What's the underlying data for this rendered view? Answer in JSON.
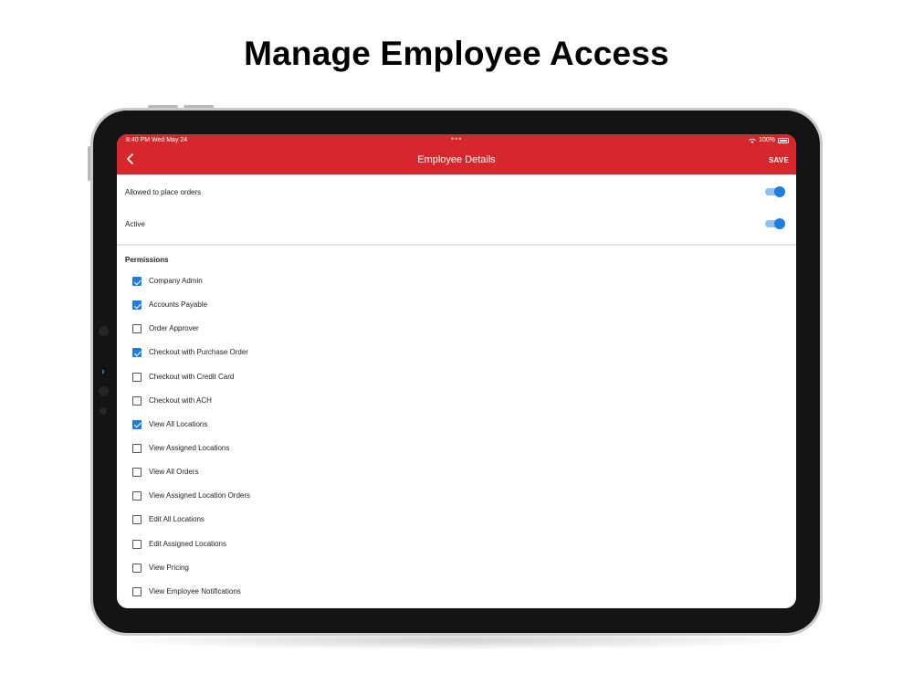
{
  "headline": "Manage Employee Access",
  "status_bar": {
    "time": "8:40 PM  Wed May 24",
    "center": "•••",
    "battery": "100%"
  },
  "app_bar": {
    "title": "Employee Details",
    "save_label": "SAVE",
    "back_icon": "chevron-left-icon",
    "color": "#d8262e"
  },
  "toggles": [
    {
      "label": "Allowed to place orders",
      "on": true
    },
    {
      "label": "Active",
      "on": true
    }
  ],
  "permissions": {
    "title": "Permissions",
    "items": [
      {
        "label": "Company Admin",
        "checked": true
      },
      {
        "label": "Accounts Payable",
        "checked": true
      },
      {
        "label": "Order Approver",
        "checked": false
      },
      {
        "label": "Checkout with Purchase Order",
        "checked": true
      },
      {
        "label": "Checkout with Credit Card",
        "checked": false
      },
      {
        "label": "Checkout with ACH",
        "checked": false
      },
      {
        "label": "View All Locations",
        "checked": true
      },
      {
        "label": "View Assigned Locations",
        "checked": false
      },
      {
        "label": "View All Orders",
        "checked": false
      },
      {
        "label": "View Assigned Location Orders",
        "checked": false
      },
      {
        "label": "Edit All Locations",
        "checked": false
      },
      {
        "label": "Edit Assigned Locations",
        "checked": false
      },
      {
        "label": "View Pricing",
        "checked": false
      },
      {
        "label": "View Employee Notifications",
        "checked": false
      }
    ]
  },
  "colors": {
    "accent": "#1f7de0",
    "brand_red": "#d8262e"
  }
}
